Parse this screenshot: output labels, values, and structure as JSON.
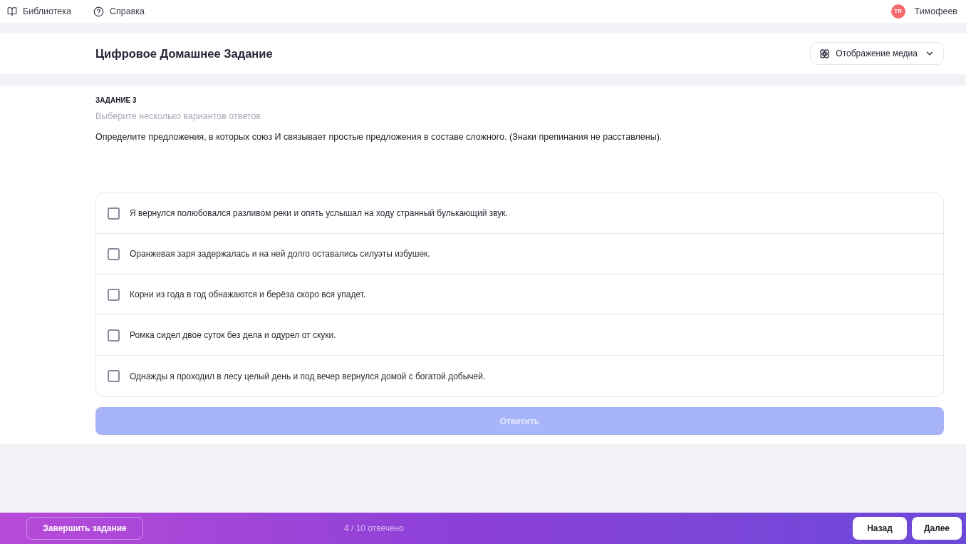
{
  "top_bar": {
    "library_link": {
      "label": "Библиотека"
    },
    "help_link": {
      "label": "Справка"
    },
    "user": {
      "initials": "ТЯ",
      "name": "Тимофеев"
    }
  },
  "header": {
    "title": "Цифровое Домашнее Задание",
    "media_button": {
      "label": "Отображение медиа"
    }
  },
  "task": {
    "number_label": "ЗАДАНИЕ 3",
    "instruction": "Выберите несколько вариантов ответов",
    "question": "Определите предложения, в которых союз И связывает простые предложения в составе сложного. (Знаки препинания не расставлены).",
    "options": [
      {
        "text": "Я вернулся полюбовался разливом реки и опять услышал на ходу странный булькающий звук.",
        "checked": false
      },
      {
        "text": "Оранжевая заря задержалась и на ней долго оставались силуэты избушек.",
        "checked": false
      },
      {
        "text": "Корни из года в год обнажаются и берёза скоро вся упадет.",
        "checked": false
      },
      {
        "text": "Ромка сидел двое суток без дела и одурел от скуки.",
        "checked": false
      },
      {
        "text": "Однажды я проходил в лесу целый день и под вечер вернулся домой с богатой добычей.",
        "checked": false
      }
    ],
    "submit_button": {
      "label": "Ответить",
      "disabled": true
    }
  },
  "footer": {
    "finish_button": {
      "label": "Завершить задание"
    },
    "progress": "4 / 10 отвечено",
    "back_button": {
      "label": "Назад"
    },
    "next_button": {
      "label": "Далее"
    }
  }
}
